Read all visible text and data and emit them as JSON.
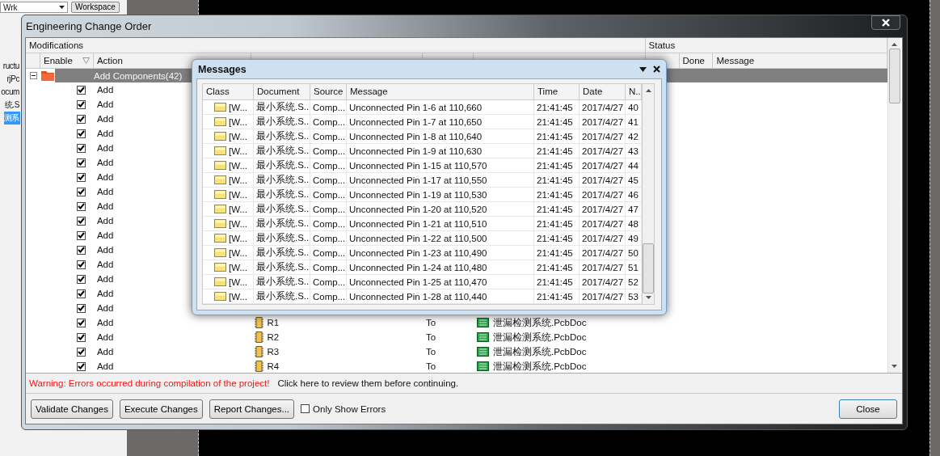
{
  "background_panel": {
    "dropdown": "Wrk",
    "button": "Workspace",
    "items": [
      {
        "label": "ructu",
        "selected": false
      },
      {
        "label": "rjPc",
        "selected": false
      },
      {
        "label": "ocum",
        "selected": false
      },
      {
        "label": "统.S",
        "selected": false
      },
      {
        "label": "测系",
        "selected": true
      }
    ]
  },
  "window": {
    "title": "Engineering Change Order"
  },
  "modifications": {
    "title": "Modifications",
    "columns": [
      "Enable",
      "Action"
    ],
    "group": {
      "label": "Add Components(42)",
      "expanded": true,
      "selected": true
    },
    "rows": [
      {
        "enabled": true,
        "action": "Add"
      },
      {
        "enabled": true,
        "action": "Add"
      },
      {
        "enabled": true,
        "action": "Add"
      },
      {
        "enabled": true,
        "action": "Add"
      },
      {
        "enabled": true,
        "action": "Add"
      },
      {
        "enabled": true,
        "action": "Add"
      },
      {
        "enabled": true,
        "action": "Add"
      },
      {
        "enabled": true,
        "action": "Add"
      },
      {
        "enabled": true,
        "action": "Add"
      },
      {
        "enabled": true,
        "action": "Add"
      },
      {
        "enabled": true,
        "action": "Add"
      },
      {
        "enabled": true,
        "action": "Add"
      },
      {
        "enabled": true,
        "action": "Add"
      },
      {
        "enabled": true,
        "action": "Add"
      },
      {
        "enabled": true,
        "action": "Add"
      },
      {
        "enabled": true,
        "action": "Add"
      },
      {
        "enabled": true,
        "action": "Add",
        "object": "R1",
        "to": "To",
        "document": "泄漏检测系统.PcbDoc"
      },
      {
        "enabled": true,
        "action": "Add",
        "object": "R2",
        "to": "To",
        "document": "泄漏检测系统.PcbDoc"
      },
      {
        "enabled": true,
        "action": "Add",
        "object": "R3",
        "to": "To",
        "document": "泄漏检测系统.PcbDoc"
      },
      {
        "enabled": true,
        "action": "Add",
        "object": "R4",
        "to": "To",
        "document": "泄漏检测系统.PcbDoc"
      }
    ]
  },
  "status": {
    "title": "Status",
    "columns": [
      "Done",
      "Message"
    ]
  },
  "warning": {
    "error": "Warning: Errors occurred during compilation of the project!",
    "hint": "Click here to review them before continuing."
  },
  "buttons": [
    {
      "label": "Validate Changes",
      "kind": "button"
    },
    {
      "label": "Execute Changes",
      "kind": "button"
    },
    {
      "label": "Report Changes...",
      "kind": "button"
    },
    {
      "label": "Only Show Errors",
      "kind": "checkbox",
      "checked": false
    }
  ],
  "close_button": "Close",
  "messages": {
    "title": "Messages",
    "columns": [
      "Class",
      "Document",
      "Source",
      "Message",
      "Time",
      "Date",
      "N.."
    ],
    "rows": [
      {
        "class": "[W...",
        "document": "最小系统.S...",
        "source": "Comp...",
        "message": "Unconnected Pin 1-6 at 110,660",
        "time": "21:41:45",
        "date": "2017/4/27",
        "number": "40"
      },
      {
        "class": "[W...",
        "document": "最小系统.S...",
        "source": "Comp...",
        "message": "Unconnected Pin 1-7 at 110,650",
        "time": "21:41:45",
        "date": "2017/4/27",
        "number": "41"
      },
      {
        "class": "[W...",
        "document": "最小系统.S...",
        "source": "Comp...",
        "message": "Unconnected Pin 1-8 at 110,640",
        "time": "21:41:45",
        "date": "2017/4/27",
        "number": "42"
      },
      {
        "class": "[W...",
        "document": "最小系统.S...",
        "source": "Comp...",
        "message": "Unconnected Pin 1-9 at 110,630",
        "time": "21:41:45",
        "date": "2017/4/27",
        "number": "43"
      },
      {
        "class": "[W...",
        "document": "最小系统.S...",
        "source": "Comp...",
        "message": "Unconnected Pin 1-15 at 110,570",
        "time": "21:41:45",
        "date": "2017/4/27",
        "number": "44"
      },
      {
        "class": "[W...",
        "document": "最小系统.S...",
        "source": "Comp...",
        "message": "Unconnected Pin 1-17 at 110,550",
        "time": "21:41:45",
        "date": "2017/4/27",
        "number": "45"
      },
      {
        "class": "[W...",
        "document": "最小系统.S...",
        "source": "Comp...",
        "message": "Unconnected Pin 1-19 at 110,530",
        "time": "21:41:45",
        "date": "2017/4/27",
        "number": "46"
      },
      {
        "class": "[W...",
        "document": "最小系统.S...",
        "source": "Comp...",
        "message": "Unconnected Pin 1-20 at 110,520",
        "time": "21:41:45",
        "date": "2017/4/27",
        "number": "47"
      },
      {
        "class": "[W...",
        "document": "最小系统.S...",
        "source": "Comp...",
        "message": "Unconnected Pin 1-21 at 110,510",
        "time": "21:41:45",
        "date": "2017/4/27",
        "number": "48"
      },
      {
        "class": "[W...",
        "document": "最小系统.S...",
        "source": "Comp...",
        "message": "Unconnected Pin 1-22 at 110,500",
        "time": "21:41:45",
        "date": "2017/4/27",
        "number": "49"
      },
      {
        "class": "[W...",
        "document": "最小系统.S...",
        "source": "Comp...",
        "message": "Unconnected Pin 1-23 at 110,490",
        "time": "21:41:45",
        "date": "2017/4/27",
        "number": "50"
      },
      {
        "class": "[W...",
        "document": "最小系统.S...",
        "source": "Comp...",
        "message": "Unconnected Pin 1-24 at 110,480",
        "time": "21:41:45",
        "date": "2017/4/27",
        "number": "51"
      },
      {
        "class": "[W...",
        "document": "最小系统.S...",
        "source": "Comp...",
        "message": "Unconnected Pin 1-25 at 110,470",
        "time": "21:41:45",
        "date": "2017/4/27",
        "number": "52"
      },
      {
        "class": "[W...",
        "document": "最小系统.S...",
        "source": "Comp...",
        "message": "Unconnected Pin 1-28 at 110,440",
        "time": "21:41:45",
        "date": "2017/4/27",
        "number": "53"
      }
    ]
  }
}
